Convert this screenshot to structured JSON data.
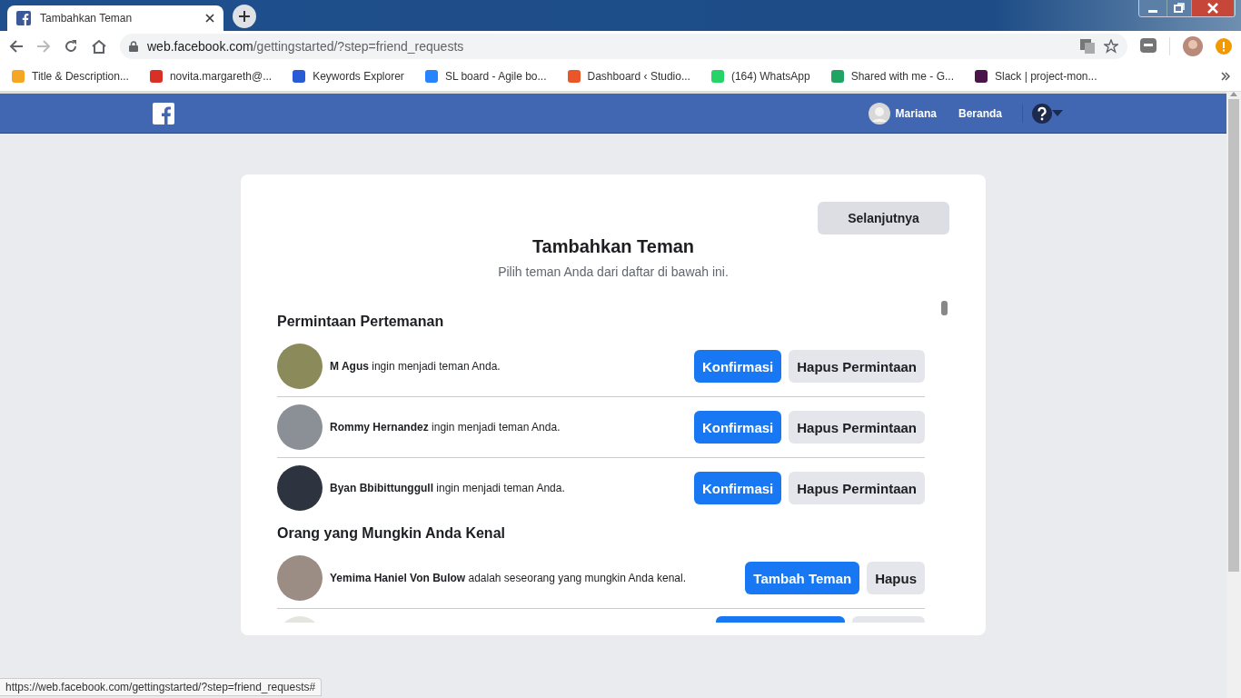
{
  "browser": {
    "tab": {
      "title": "Tambahkan Teman"
    },
    "address": {
      "host": "web.facebook.com",
      "path": "/gettingstarted/?step=friend_requests"
    },
    "bookmarks": [
      {
        "label": "Title & Description...",
        "color": "#f5a623"
      },
      {
        "label": "novita.margareth@...",
        "color": "#d93025"
      },
      {
        "label": "Keywords Explorer",
        "color": "#2a5bd7"
      },
      {
        "label": "SL board - Agile bo...",
        "color": "#2684ff"
      },
      {
        "label": "Dashboard ‹ Studio...",
        "color": "#e8562a"
      },
      {
        "label": "(164) WhatsApp",
        "color": "#25d366"
      },
      {
        "label": "Shared with me - G...",
        "color": "#1fa463"
      },
      {
        "label": "Slack | project-mon...",
        "color": "#4a154b"
      }
    ]
  },
  "topbar": {
    "user": "Mariana",
    "home": "Beranda"
  },
  "card": {
    "next_button": "Selanjutnya",
    "title": "Tambahkan Teman",
    "subtitle": "Pilih teman Anda dari daftar di bawah ini.",
    "sections": [
      {
        "heading": "Permintaan Pertemanan",
        "rows": [
          {
            "kind": "full",
            "text": "**M Agus** ingin menjadi teman Anda.",
            "primary": "Konfirmasi",
            "secondary": "Hapus Permintaan"
          },
          {
            "kind": "full",
            "text": "**Rommy Hernandez** ingin menjadi teman Anda.",
            "primary": "Konfirmasi",
            "secondary": "Hapus Permintaan"
          },
          {
            "kind": "full",
            "text": "**Byan Bbibittunggull** ingin menjadi teman Anda.",
            "primary": "Konfirmasi",
            "secondary": "Hapus Permintaan"
          }
        ]
      },
      {
        "heading": "Orang yang Mungkin Anda Kenal",
        "rows": [
          {
            "kind": "full",
            "text": "**Yemima Haniel Von Bulow** adalah seseorang yang mungkin Anda kenal.",
            "primary": "Tambah Teman",
            "secondary": "Hapus"
          },
          {
            "kind": "cut_off"
          }
        ]
      }
    ]
  },
  "status_url": "https://web.facebook.com/gettingstarted/?step=friend_requests#"
}
